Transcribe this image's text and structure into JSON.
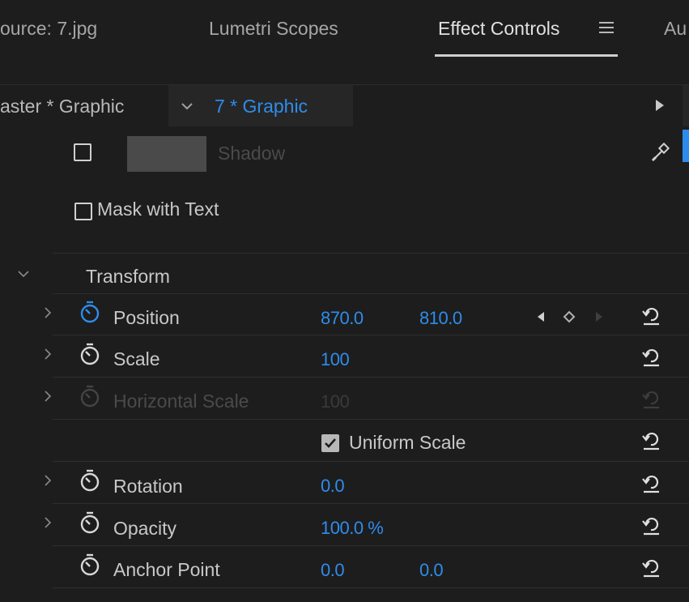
{
  "tabs": [
    {
      "label": "ource: 7.jpg"
    },
    {
      "label": "Lumetri Scopes"
    },
    {
      "label": "Effect Controls"
    },
    {
      "label": "Au"
    }
  ],
  "clip_header": {
    "master_label": "aster * Graphic",
    "sequence_label": "7 * Graphic"
  },
  "appearance": {
    "shadow_label": "Shadow",
    "mask_with_text_label": "Mask with Text"
  },
  "transform": {
    "section_label": "Transform",
    "position": {
      "label": "Position",
      "x": "870.0",
      "y": "810.0"
    },
    "scale": {
      "label": "Scale",
      "value": "100"
    },
    "horizontal_scale": {
      "label": "Horizontal Scale",
      "value": "100"
    },
    "uniform_scale": {
      "label": "Uniform Scale",
      "checked": true
    },
    "rotation": {
      "label": "Rotation",
      "value": "0.0"
    },
    "opacity": {
      "label": "Opacity",
      "value": "100.0",
      "unit": "%"
    },
    "anchor_point": {
      "label": "Anchor Point",
      "x": "0.0",
      "y": "0.0"
    }
  },
  "colors": {
    "background": "#1d1d1d",
    "value_blue": "#2f8ceb",
    "label": "#c8c8c8",
    "disabled": "#4a4a4a"
  },
  "icons": [
    "panel-menu-icon",
    "dropdown-chevron-icon",
    "play-triangle-icon",
    "eyedropper-icon",
    "stopwatch-icon",
    "reset-icon",
    "expand-chevron-icon",
    "keyframe-nav-icon"
  ]
}
